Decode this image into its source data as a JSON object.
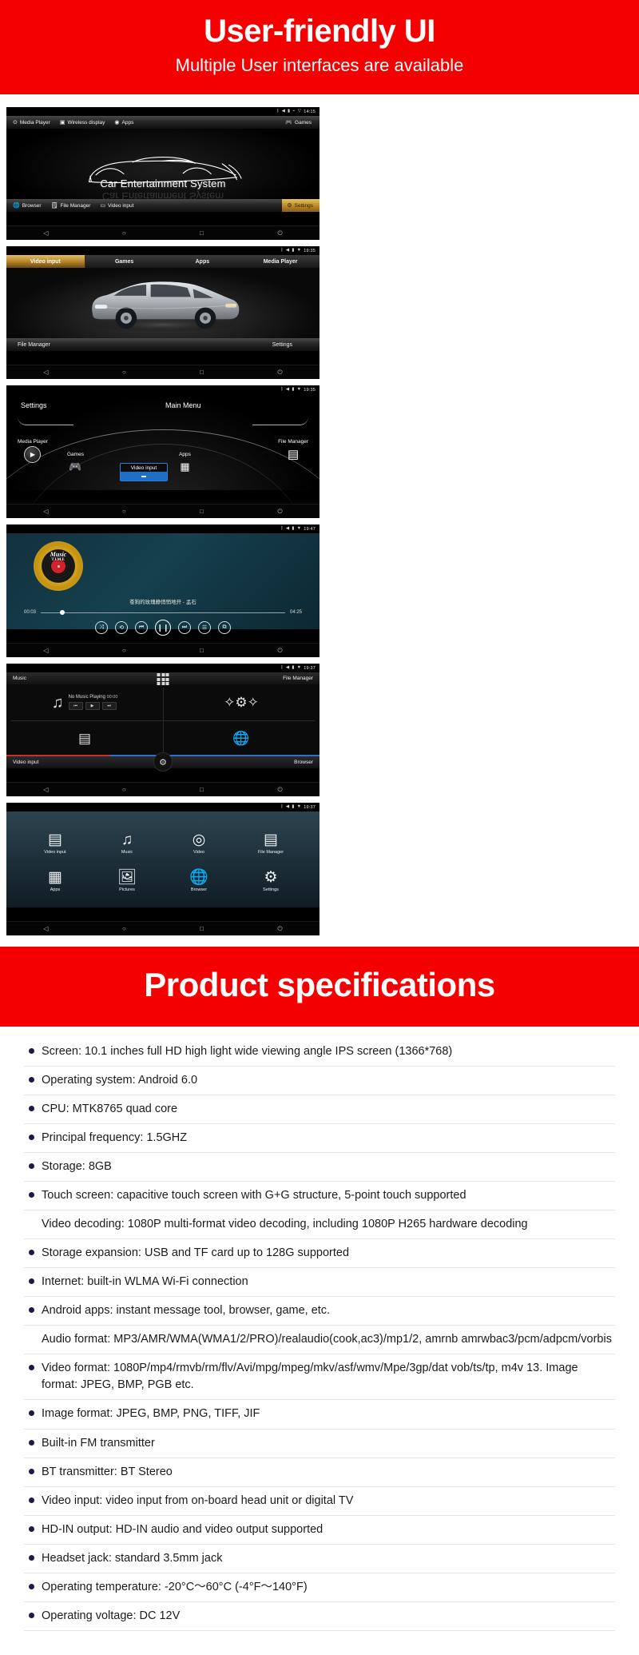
{
  "banner_top": {
    "title": "User-friendly UI",
    "subtitle": "Multiple User interfaces are available",
    "color": "#f50000"
  },
  "banner_specs": {
    "title": "Product specifications",
    "color": "#f50000"
  },
  "panels": [
    {
      "id": "car-entertainment-home",
      "status": {
        "time": "14:15",
        "icons": [
          "bluetooth-icon",
          "mute-icon",
          "sd-card-icon",
          "usb-icon",
          "wifi-icon"
        ]
      },
      "top_menu": [
        {
          "label": "Media Player",
          "icon": "play-circle-icon"
        },
        {
          "label": "Wireless display",
          "icon": "cast-screen-icon"
        },
        {
          "label": "Apps",
          "icon": "apps-circle-icon"
        },
        {
          "label": "Games",
          "icon": "gamepad-icon"
        }
      ],
      "hero_text": "Car Entertainment System",
      "bottom_menu": [
        {
          "label": "Browser",
          "icon": "globe-icon"
        },
        {
          "label": "File Manager",
          "icon": "folder-icon"
        },
        {
          "label": "Video input",
          "icon": "video-input-icon"
        },
        {
          "label": "Settings",
          "icon": "gear-icon",
          "active": true
        }
      ],
      "navbar": [
        "back-icon",
        "home-icon",
        "recents-icon",
        "power-icon"
      ]
    },
    {
      "id": "video-input-tabs",
      "status": {
        "time": "19:35",
        "icons": [
          "bluetooth-icon",
          "mute-icon",
          "sd-card-icon",
          "wifi-icon"
        ]
      },
      "tabs": [
        {
          "label": "Video input",
          "active": true
        },
        {
          "label": "Games",
          "active": false
        },
        {
          "label": "Apps",
          "active": false
        },
        {
          "label": "Media Player",
          "active": false
        }
      ],
      "bottom_left": "File Manager",
      "bottom_right": "Settings",
      "navbar": [
        "back-icon",
        "home-icon",
        "recents-icon",
        "power-icon"
      ]
    },
    {
      "id": "main-menu-arc",
      "status": {
        "time": "19:35",
        "icons": [
          "bluetooth-icon",
          "mute-icon",
          "sd-card-icon",
          "wifi-icon"
        ]
      },
      "header_left": "Settings",
      "header_center": "Main Menu",
      "header_right": "File Manager",
      "items": [
        {
          "label": "Media Player",
          "icon": "play-circle-icon"
        },
        {
          "label": "Games",
          "icon": "gamepad-icon"
        },
        {
          "label": "Video input",
          "icon": "video-input-icon",
          "selected": true
        },
        {
          "label": "Apps",
          "icon": "apps-grid-icon"
        },
        {
          "label": "File Manager",
          "icon": "folder-icon"
        }
      ],
      "navbar": [
        "back-icon",
        "home-icon",
        "recents-icon",
        "power-icon"
      ]
    },
    {
      "id": "music-player",
      "status": {
        "time": "19:47",
        "icons": [
          "bluetooth-icon",
          "mute-icon",
          "sd-card-icon",
          "wifi-icon"
        ]
      },
      "vinyl_label_top": "Music",
      "vinyl_label_bottom": "TIME",
      "track_title": "苍狗的玫瑰静悄悄地开 - 孟石",
      "time_elapsed": "00:03",
      "time_total": "04:25",
      "progress_percent": 8,
      "controls": [
        "shuffle-icon",
        "repeat-icon",
        "previous-icon",
        "pause-icon",
        "next-icon",
        "playlist-icon",
        "equalizer-icon"
      ],
      "navbar": [
        "back-icon",
        "home-icon",
        "recents-icon",
        "power-icon"
      ]
    },
    {
      "id": "music-file-manager",
      "status": {
        "time": "19:37",
        "icons": [
          "bluetooth-icon",
          "mute-icon",
          "sd-card-icon",
          "wifi-icon"
        ]
      },
      "top_left": "Music",
      "top_center_icon": "apps-grid-icon",
      "top_right": "File Manager",
      "now_playing": "No Music Playing",
      "now_playing_time": "00:00",
      "transport": [
        "previous-icon",
        "play-icon",
        "next-icon"
      ],
      "tiles": [
        "settings-sparkle-icon",
        "video-input-icon",
        "globe-icon"
      ],
      "center_icon": "gear-icon",
      "bottom_left": "Video input",
      "bottom_right": "Browser",
      "navbar": [
        "back-icon",
        "home-icon",
        "recents-icon",
        "power-icon"
      ]
    },
    {
      "id": "app-grid",
      "status": {
        "time": "19:37",
        "icons": [
          "bluetooth-icon",
          "mute-icon",
          "sd-card-icon",
          "wifi-icon"
        ]
      },
      "apps": [
        {
          "label": "Video input",
          "icon": "video-input-icon"
        },
        {
          "label": "Music",
          "icon": "music-note-icon"
        },
        {
          "label": "Video",
          "icon": "film-reel-icon"
        },
        {
          "label": "File Manager",
          "icon": "folder-icon"
        },
        {
          "label": "Apps",
          "icon": "apps-grid-icon"
        },
        {
          "label": "Pictures",
          "icon": "photo-icon"
        },
        {
          "label": "Browser",
          "icon": "globe-icon"
        },
        {
          "label": "Settings",
          "icon": "gear-icon"
        }
      ],
      "navbar": [
        "back-icon",
        "home-icon",
        "recents-icon",
        "power-icon"
      ]
    }
  ],
  "specifications": [
    {
      "bullet": true,
      "text": "Screen: 10.1 inches full HD high light wide viewing angle IPS screen (1366*768)"
    },
    {
      "bullet": true,
      "text": "Operating system: Android 6.0"
    },
    {
      "bullet": true,
      "text": "CPU: MTK8765 quad core"
    },
    {
      "bullet": true,
      "text": "Principal frequency: 1.5GHZ"
    },
    {
      "bullet": true,
      "text": "Storage: 8GB"
    },
    {
      "bullet": true,
      "text": "Touch screen: capacitive touch screen with G+G structure, 5-point touch supported"
    },
    {
      "bullet": false,
      "text": "Video decoding: 1080P multi-format video decoding, including 1080P H265 hardware decoding"
    },
    {
      "bullet": true,
      "text": "Storage expansion: USB and TF card up to 128G supported"
    },
    {
      "bullet": true,
      "text": "Internet: built-in WLMA Wi-Fi connection"
    },
    {
      "bullet": true,
      "text": "Android apps: instant message tool, browser, game, etc."
    },
    {
      "bullet": false,
      "text": "Audio format: MP3/AMR/WMA(WMA1/2/PRO)/realaudio(cook,ac3)/mp1/2, amrnb amrwbac3/pcm/adpcm/vorbis"
    },
    {
      "bullet": true,
      "text": "Video format: 1080P/mp4/rmvb/rm/flv/Avi/mpg/mpeg/mkv/asf/wmv/Mpe/3gp/dat vob/ts/tp, m4v 13. Image format: JPEG, BMP, PGB etc."
    },
    {
      "bullet": true,
      "text": "Image format: JPEG, BMP, PNG, TIFF, JIF"
    },
    {
      "bullet": true,
      "text": "Built-in FM transmitter"
    },
    {
      "bullet": true,
      "text": "BT transmitter: BT Stereo"
    },
    {
      "bullet": true,
      "text": "Video input: video input from on-board head unit or digital TV"
    },
    {
      "bullet": true,
      "text": "HD-IN output: HD-IN audio and video output supported"
    },
    {
      "bullet": true,
      "text": "Headset jack: standard 3.5mm jack"
    },
    {
      "bullet": true,
      "text": "Operating temperature: -20°C～60°C (-4°F～140°F)"
    },
    {
      "bullet": true,
      "text": "Operating voltage: DC 12V"
    }
  ]
}
